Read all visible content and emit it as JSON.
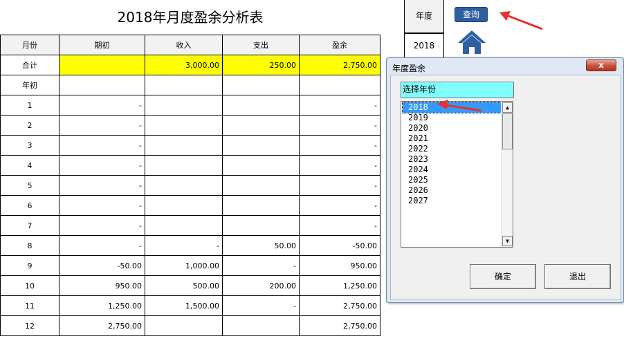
{
  "title": "2018年月度盈余分析表",
  "header": [
    "月份",
    "期初",
    "收入",
    "支出",
    "盈余"
  ],
  "total_row": {
    "label": "合计",
    "opening": "",
    "income": "3,000.00",
    "expense": "250.00",
    "surplus": "2,750.00"
  },
  "year_start_row": {
    "label": "年初"
  },
  "rows": [
    {
      "month": "1",
      "opening": "-",
      "income": "",
      "expense": "",
      "surplus": "-"
    },
    {
      "month": "2",
      "opening": "-",
      "income": "",
      "expense": "",
      "surplus": "-"
    },
    {
      "month": "3",
      "opening": "-",
      "income": "",
      "expense": "",
      "surplus": "-"
    },
    {
      "month": "4",
      "opening": "-",
      "income": "",
      "expense": "",
      "surplus": "-"
    },
    {
      "month": "5",
      "opening": "-",
      "income": "",
      "expense": "",
      "surplus": "-"
    },
    {
      "month": "6",
      "opening": "-",
      "income": "",
      "expense": "",
      "surplus": "-"
    },
    {
      "month": "7",
      "opening": "-",
      "income": "",
      "expense": "",
      "surplus": "-"
    },
    {
      "month": "8",
      "opening": "-",
      "income": "-",
      "expense": "50.00",
      "surplus": "-50.00"
    },
    {
      "month": "9",
      "opening": "-50.00",
      "income": "1,000.00",
      "expense": "-",
      "surplus": "950.00"
    },
    {
      "month": "10",
      "opening": "950.00",
      "income": "500.00",
      "expense": "200.00",
      "surplus": "1,250.00"
    },
    {
      "month": "11",
      "opening": "1,250.00",
      "income": "1,500.00",
      "expense": "-",
      "surplus": "2,750.00"
    },
    {
      "month": "12",
      "opening": "2,750.00",
      "income": "",
      "expense": "",
      "surplus": "2,750.00"
    }
  ],
  "year_panel": {
    "label": "年度",
    "value": "2018",
    "query_button": "查询",
    "home_icon": "home-icon"
  },
  "dialog": {
    "title": "年度盈余",
    "close_label": "x",
    "choose_label": "选择年份",
    "years": [
      "2018",
      "2019",
      "2020",
      "2021",
      "2022",
      "2023",
      "2024",
      "2025",
      "2026",
      "2027"
    ],
    "selected": "2018",
    "ok_button": "确定",
    "exit_button": "退出"
  },
  "colors": {
    "total_highlight": "#ffff00",
    "query_button": "#2e5fa3",
    "home_icon": "#2e5fa3",
    "choose_label_bg": "#80ffff",
    "list_selected": "#3399ff",
    "arrow": "#e8302c"
  }
}
